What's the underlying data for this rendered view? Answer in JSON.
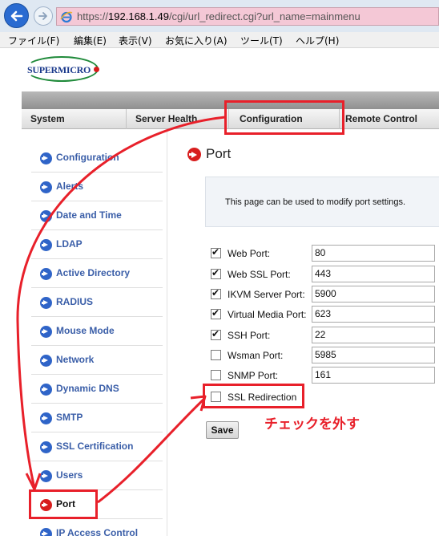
{
  "browser": {
    "url_prefix": "https://",
    "url_host": "192.168.1.49",
    "url_path": "/cgi/url_redirect.cgi?url_name=mainmenu",
    "icons": {
      "back": "back-arrow-icon",
      "forward": "forward-arrow-icon",
      "site": "ie-logo-icon"
    },
    "colors": {
      "address_bg": "#f4c8d6",
      "back_button": "#2a6bd1"
    }
  },
  "menubar": {
    "items": [
      "ファイル(F)",
      "編集(E)",
      "表示(V)",
      "お気に入り(A)",
      "ツール(T)",
      "ヘルプ(H)"
    ]
  },
  "brand": {
    "logo_text": "SUPERMICRO",
    "colors": {
      "text": "#1b3a8c",
      "ring": "#1f8a3a",
      "dot": "#d61a1a"
    }
  },
  "topnav": {
    "tabs": [
      "System",
      "Server Health",
      "Configuration",
      "Remote Control"
    ],
    "active": "Configuration"
  },
  "sidebar": {
    "items": [
      {
        "label": "Configuration",
        "active": false
      },
      {
        "label": "Alerts",
        "active": false
      },
      {
        "label": "Date and Time",
        "active": false
      },
      {
        "label": "LDAP",
        "active": false
      },
      {
        "label": "Active Directory",
        "active": false
      },
      {
        "label": "RADIUS",
        "active": false
      },
      {
        "label": "Mouse Mode",
        "active": false
      },
      {
        "label": "Network",
        "active": false
      },
      {
        "label": "Dynamic DNS",
        "active": false
      },
      {
        "label": "SMTP",
        "active": false
      },
      {
        "label": "SSL Certification",
        "active": false
      },
      {
        "label": "Users",
        "active": false
      },
      {
        "label": "Port",
        "active": true
      },
      {
        "label": "IP Access Control",
        "active": false
      }
    ],
    "colors": {
      "link": "#3a5ea8",
      "icon": "#2f64c8",
      "active_icon": "#d81e1e"
    }
  },
  "page": {
    "title": "Port",
    "info": "This page can be used to modify port settings.",
    "fields": [
      {
        "label": "Web Port:",
        "value": "80",
        "checked": true
      },
      {
        "label": "Web SSL Port:",
        "value": "443",
        "checked": true
      },
      {
        "label": "IKVM Server Port:",
        "value": "5900",
        "checked": true
      },
      {
        "label": "Virtual Media Port:",
        "value": "623",
        "checked": true
      },
      {
        "label": "SSH Port:",
        "value": "22",
        "checked": true
      },
      {
        "label": "Wsman Port:",
        "value": "5985",
        "checked": false
      },
      {
        "label": "SNMP Port:",
        "value": "161",
        "checked": false
      }
    ],
    "ssl_redirection": {
      "label": "SSL Redirection",
      "checked": false
    },
    "save_label": "Save"
  },
  "annotation": {
    "note": "チェックを外す",
    "color": "#e8202a"
  }
}
